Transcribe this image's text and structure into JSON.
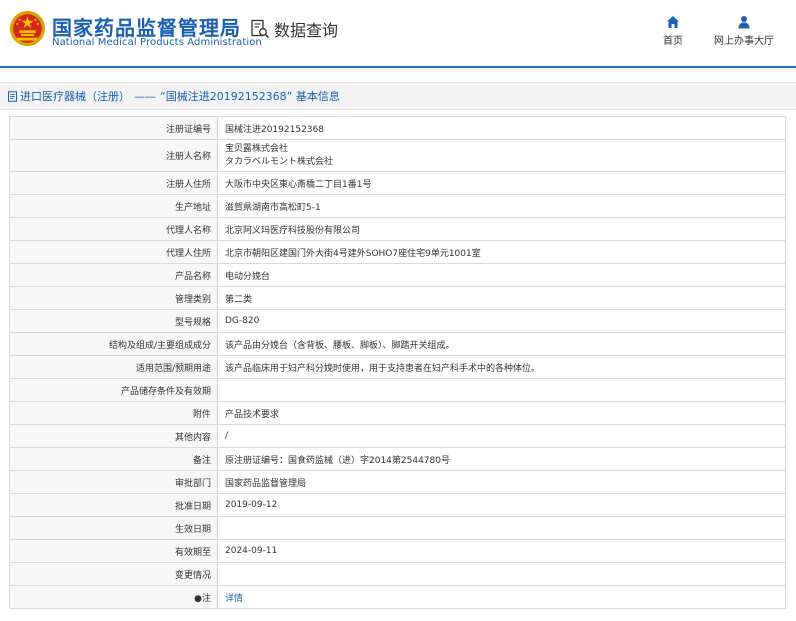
{
  "header": {
    "title": "国家药品监督管理局",
    "subtitle": "National Medical Products Administration",
    "query_label": "数据查询",
    "nav": [
      {
        "label": "首页",
        "icon": "home-icon"
      },
      {
        "label": "网上办事大厅",
        "icon": "person-icon"
      }
    ],
    "accent": "#1f6fc5"
  },
  "breadcrumb": {
    "category": "进口医疗器械（注册）",
    "separator": "——",
    "current": "“国械注进20192152368” 基本信息"
  },
  "record": {
    "rows": [
      {
        "label": "注册证编号",
        "value": "国械注进20192152368"
      },
      {
        "label": "注册人名称",
        "lines": [
          "宝贝露株式会社",
          "タカラベルモント株式会社"
        ]
      },
      {
        "label": "注册人住所",
        "value": "大阪市中央区東心斎橋二丁目1番1号"
      },
      {
        "label": "生产地址",
        "value": "滋賀県湖南市高松町5-1"
      },
      {
        "label": "代理人名称",
        "value": "北京阿义玛医疗科技股份有限公司"
      },
      {
        "label": "代理人住所",
        "value": "北京市朝阳区建国门外大街4号建外SOHO7座住宅9单元1001室"
      },
      {
        "label": "产品名称",
        "value": "电动分娩台"
      },
      {
        "label": "管理类别",
        "value": "第二类"
      },
      {
        "label": "型号规格",
        "value": "DG-820"
      },
      {
        "label": "结构及组成/主要组成成分",
        "value": "该产品由分娩台（含背板、腰板、脚板）、脚踏开关组成。"
      },
      {
        "label": "适用范围/预期用途",
        "value": "该产品临床用于妇产科分娩时使用，用于支持患者在妇产科手术中的各种体位。"
      },
      {
        "label": "产品储存条件及有效期",
        "value": ""
      },
      {
        "label": "附件",
        "value": "产品技术要求"
      },
      {
        "label": "其他内容",
        "value": "/"
      },
      {
        "label": "备注",
        "value": "原注册证编号：国食药监械（进）字2014第2544780号"
      },
      {
        "label": "审批部门",
        "value": "国家药品监督管理局"
      },
      {
        "label": "批准日期",
        "value": "2019-09-12"
      },
      {
        "label": "生效日期",
        "value": ""
      },
      {
        "label": "有效期至",
        "value": "2024-09-11"
      },
      {
        "label": "变更情况",
        "value": ""
      },
      {
        "label": "注",
        "value": "详情",
        "pin": "●"
      }
    ]
  }
}
